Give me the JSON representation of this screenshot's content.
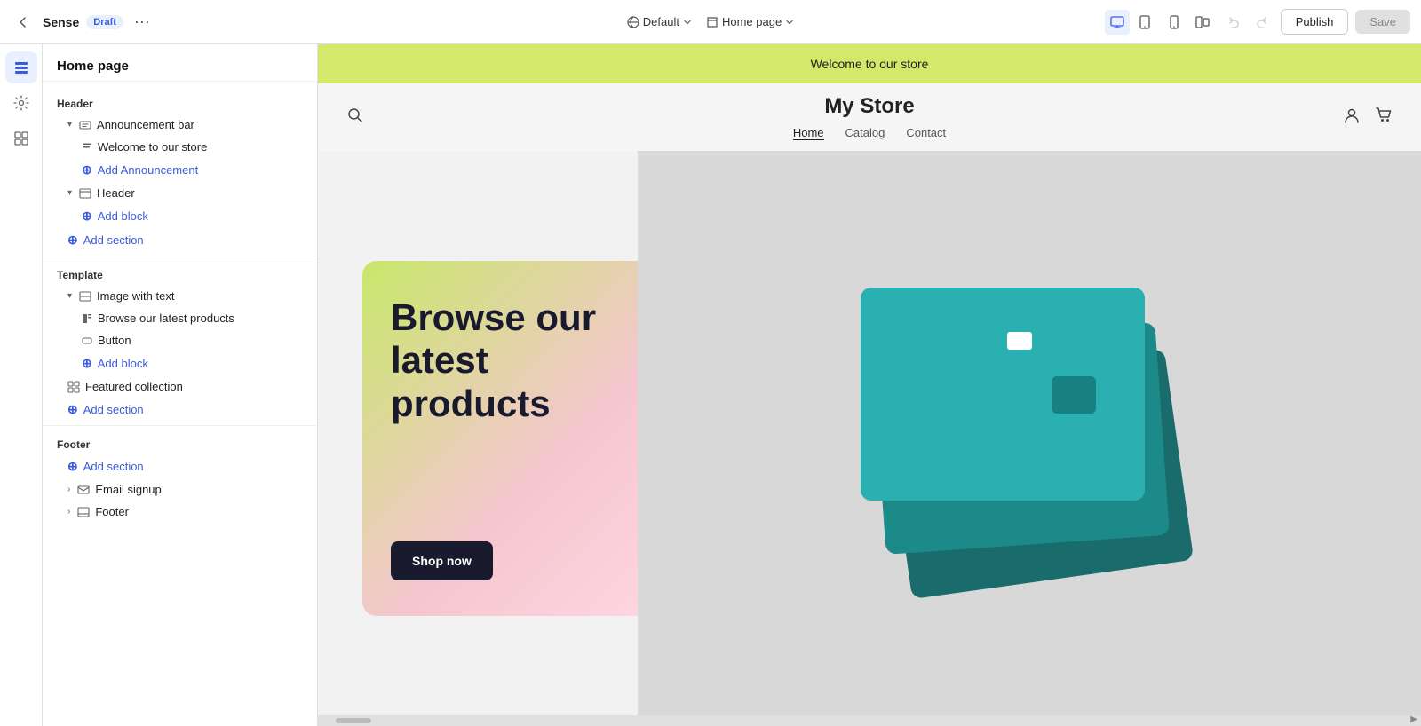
{
  "topbar": {
    "back_label": "←",
    "app_name": "Sense",
    "draft_badge": "Draft",
    "more_icon": "•••",
    "viewport_label": "Default",
    "page_label": "Home page",
    "publish_label": "Publish",
    "save_label": "Save"
  },
  "icon_sidebar": {
    "items": [
      {
        "icon": "⊕",
        "name": "add",
        "active": false
      },
      {
        "icon": "⚙",
        "name": "settings",
        "active": false
      },
      {
        "icon": "⊞",
        "name": "grid",
        "active": false
      }
    ]
  },
  "left_panel": {
    "title": "Home page",
    "sections": {
      "header_label": "Header",
      "announcement_bar_label": "Announcement bar",
      "announcement_text": "Welcome to our store",
      "add_announcement_label": "Add Announcement",
      "header_label2": "Header",
      "add_block_label": "Add block",
      "add_section_label1": "Add section",
      "template_label": "Template",
      "image_with_text_label": "Image with text",
      "browse_text": "Browse our latest products",
      "button_label": "Button",
      "add_block_label2": "Add block",
      "featured_collection_label": "Featured collection",
      "add_section_label2": "Add section",
      "footer_label": "Footer",
      "add_section_label3": "Add section",
      "email_signup_label": "Email signup",
      "footer_item_label": "Footer"
    }
  },
  "preview": {
    "announcement_text": "Welcome to our store",
    "store_name": "My Store",
    "nav_links": [
      {
        "label": "Home",
        "active": true
      },
      {
        "label": "Catalog",
        "active": false
      },
      {
        "label": "Contact",
        "active": false
      }
    ],
    "hero_title": "Browse our latest products",
    "shop_now_label": "Shop now"
  }
}
